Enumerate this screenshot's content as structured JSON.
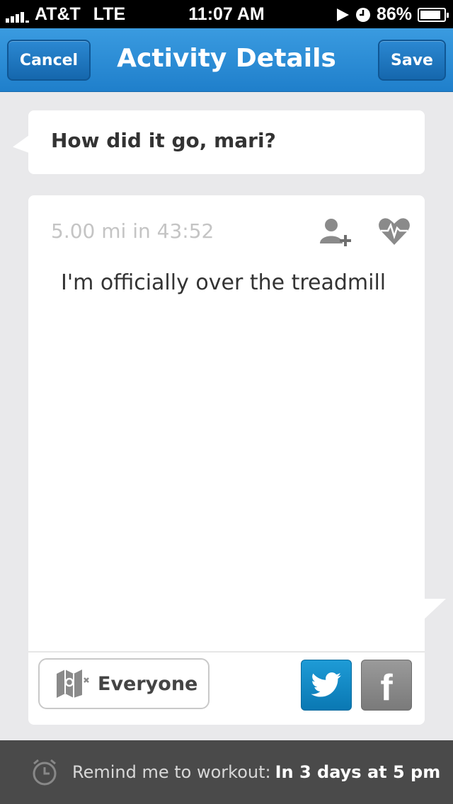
{
  "status_bar": {
    "carrier": "AT&T",
    "network": "LTE",
    "time": "11:07 AM",
    "battery": "86%",
    "battery_level": 0.86
  },
  "nav": {
    "cancel_label": "Cancel",
    "title": "Activity Details",
    "save_label": "Save",
    "accent_color": "#2a8bd6"
  },
  "question": {
    "text": "How did it go, mari?"
  },
  "activity": {
    "stats": "5.00 mi in 43:52",
    "note": "I'm officially over the treadmill",
    "tag_friend_icon": "add-person-icon",
    "health_icon": "heart-rate-icon"
  },
  "sharing": {
    "privacy_label": "Everyone",
    "privacy_icon": "map-privacy-icon",
    "twitter_icon": "twitter-icon",
    "facebook_icon": "facebook-icon",
    "twitter_color": "#1a8fcb",
    "facebook_color": "#8a8a8a"
  },
  "reminder": {
    "label": "Remind me to workout:",
    "value": "In 3 days at 5 pm",
    "icon": "alarm-clock-icon"
  }
}
